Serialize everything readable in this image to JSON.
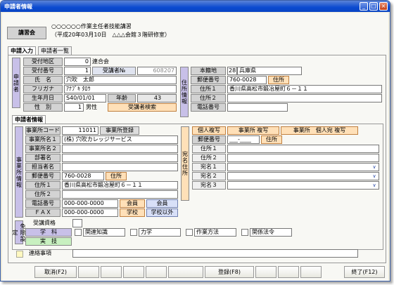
{
  "window": {
    "title": "申請者情報"
  },
  "course": {
    "label": "講習会",
    "line1": "○○○○○○作業主任者技能講習",
    "line2": "（平成20年03月10日　△△△会館３階研修室）"
  },
  "tabs": [
    "申請入力",
    "申請者一覧"
  ],
  "applicant": {
    "group": "申請者",
    "area_label": "受付地区",
    "area_code": "0",
    "area_name": "連合会",
    "num_label": "受付番号",
    "num_value": "1",
    "recv_label": "受講者№",
    "recv_value": "608207",
    "name_label": "氏　名",
    "name_value": "穴吹　太郎",
    "kana_label": "フリガナ",
    "kana_value": "ｱﾅﾌﾞｷ ﾀﾛｳ",
    "birth_label": "生年月日",
    "birth_value": "S40/01/01",
    "age_label": "年齢",
    "age_value": "43",
    "sex_label": "性　別",
    "sex_code": "1",
    "sex_value": "男性",
    "search_btn": "受講者検索"
  },
  "address": {
    "group": "住所情報",
    "honseki_label": "本籍地",
    "honseki_code": "28",
    "honseki_value": "兵庫県",
    "zip_label": "郵便番号",
    "zip_value": "760-0028",
    "addr_btn": "住所",
    "addr1_label": "住所１",
    "addr1_value": "香川県高松市鍛冶屋町６－１１",
    "addr2_label": "住所２",
    "addr2_value": "",
    "tel_label": "電話番号",
    "tel_value": ""
  },
  "section_tab": "申請者情報",
  "office": {
    "group": "事業所情報",
    "code_label": "事業所コード",
    "code_value": "11011",
    "register_btn": "事業所登録",
    "name1_label": "事業所名１",
    "name1_value": "(株) 穴吹カレッジサービス",
    "name2_label": "事業所名２",
    "dept_label": "部署名",
    "person_label": "担当者名",
    "zip_label": "郵便番号",
    "zip_value": "760-0028",
    "addr_btn": "住所",
    "addr1_label": "住所１",
    "addr1_value": "香川県高松市鍛冶屋町６－１１",
    "addr2_label": "住所２",
    "tel_label": "電話番号",
    "tel_value": "000-000-0000",
    "fax_label": "ＦＡＸ",
    "fax_value": "000-000-0000",
    "member_lbl": "会員",
    "member_val": "会員",
    "school_lbl": "学校",
    "school_val": "学校以外"
  },
  "dest": {
    "group": "宛名住所",
    "copy_btns": [
      "個人複写",
      "事業所 複写",
      "事業所　個人宛 複写"
    ],
    "zip_label": "郵便番号",
    "zip_value": "___-____",
    "addr_btn": "住所",
    "addr1_label": "住所１",
    "addr2_label": "住所２",
    "name1_label": "宛名１",
    "name2_label": "宛名２",
    "name3_label": "宛名３"
  },
  "exempt": {
    "group": "免除設定",
    "qual_label": "受講資格",
    "subject_label": "学　科",
    "practical_label": "実　技",
    "items": [
      "関連知識",
      "力学",
      "作業方法",
      "関係法令"
    ]
  },
  "contact_label": "連絡事項",
  "fkeys": {
    "cancel": "取消(F2)",
    "register": "登録(F8)",
    "end": "終了(F12)"
  },
  "colors": {
    "accent": "#0a4ad0",
    "vlabel": "#c8c0e8",
    "button": "#ffe0b8"
  }
}
